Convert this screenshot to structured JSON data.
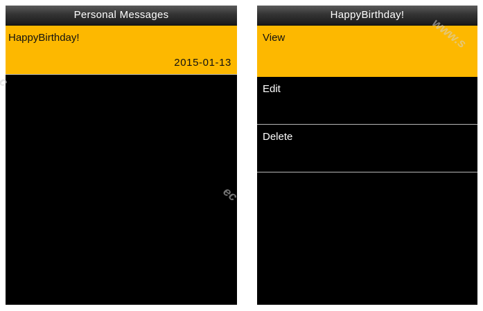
{
  "left_screen": {
    "title": "Personal Messages",
    "messages": [
      {
        "subject": "HappyBirthday!",
        "date": "2015-01-13",
        "selected": true
      }
    ]
  },
  "right_screen": {
    "title": "HappyBirthday!",
    "menu": [
      {
        "label": "View",
        "selected": true
      },
      {
        "label": "Edit",
        "selected": false
      },
      {
        "label": "Delete",
        "selected": false
      }
    ]
  },
  "colors": {
    "highlight": "#fdb800",
    "screen_background": "#000000",
    "divider": "#b8b8b8"
  }
}
